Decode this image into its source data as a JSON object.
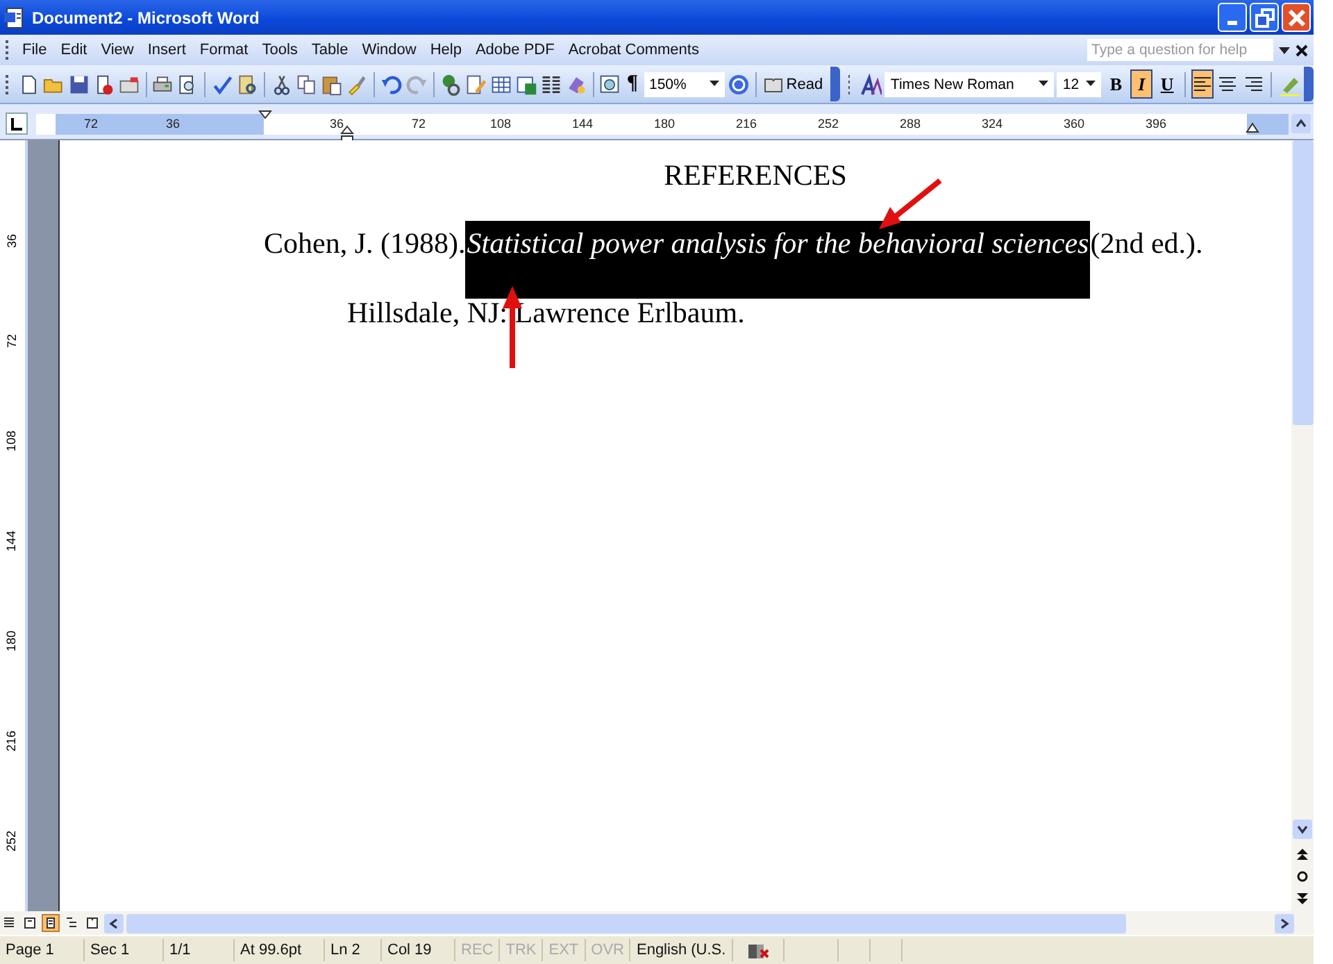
{
  "window": {
    "title": "Document2 - Microsoft Word"
  },
  "menu": [
    "File",
    "Edit",
    "View",
    "Insert",
    "Format",
    "Tools",
    "Table",
    "Window",
    "Help",
    "Adobe PDF",
    "Acrobat Comments"
  ],
  "help_box": {
    "placeholder": "Type a question for help"
  },
  "toolbar": {
    "pilcrow": "¶",
    "zoom": "150%",
    "read": "Read",
    "font": "Times New Roman",
    "size": "12",
    "format_buttons": [
      {
        "label": "B",
        "on": false
      },
      {
        "label": "I",
        "on": true
      },
      {
        "label": "U",
        "on": false
      }
    ],
    "align_buttons": [
      {
        "kind": "left",
        "selected": true
      },
      {
        "kind": "center",
        "selected": false
      },
      {
        "kind": "right",
        "selected": false
      }
    ]
  },
  "ruler": {
    "horizontal": [
      "72",
      "36",
      "36",
      "72",
      "108",
      "144",
      "180",
      "216",
      "252",
      "288",
      "324",
      "360",
      "396"
    ],
    "vertical": [
      "36",
      "72",
      "108",
      "144",
      "180",
      "216",
      "252"
    ]
  },
  "document": {
    "heading": "REFERENCES",
    "line1_start": "Cohen, J. (1988). ",
    "selected_text": "Statistical power analysis for the behavioral sciences",
    "line1_end": " (2nd ed.).",
    "line2": "Hillsdale, NJ: Lawrence Erlbaum."
  },
  "view_buttons": [
    {
      "kind": "normal",
      "selected": false
    },
    {
      "kind": "web",
      "selected": false
    },
    {
      "kind": "print",
      "selected": true
    },
    {
      "kind": "outline",
      "selected": false
    },
    {
      "kind": "reading",
      "selected": false
    }
  ],
  "status_bar": [
    {
      "text": "Page 1",
      "disabled": false
    },
    {
      "text": "Sec 1",
      "disabled": false
    },
    {
      "text": "1/1",
      "disabled": false
    },
    {
      "text": "At 99.6pt",
      "disabled": false
    },
    {
      "text": "Ln 2",
      "disabled": false
    },
    {
      "text": "Col 19",
      "disabled": false
    },
    {
      "text": "REC",
      "disabled": true
    },
    {
      "text": "TRK",
      "disabled": true
    },
    {
      "text": "EXT",
      "disabled": true
    },
    {
      "text": "OVR",
      "disabled": true
    },
    {
      "text": "English (U.S.",
      "disabled": false
    }
  ]
}
